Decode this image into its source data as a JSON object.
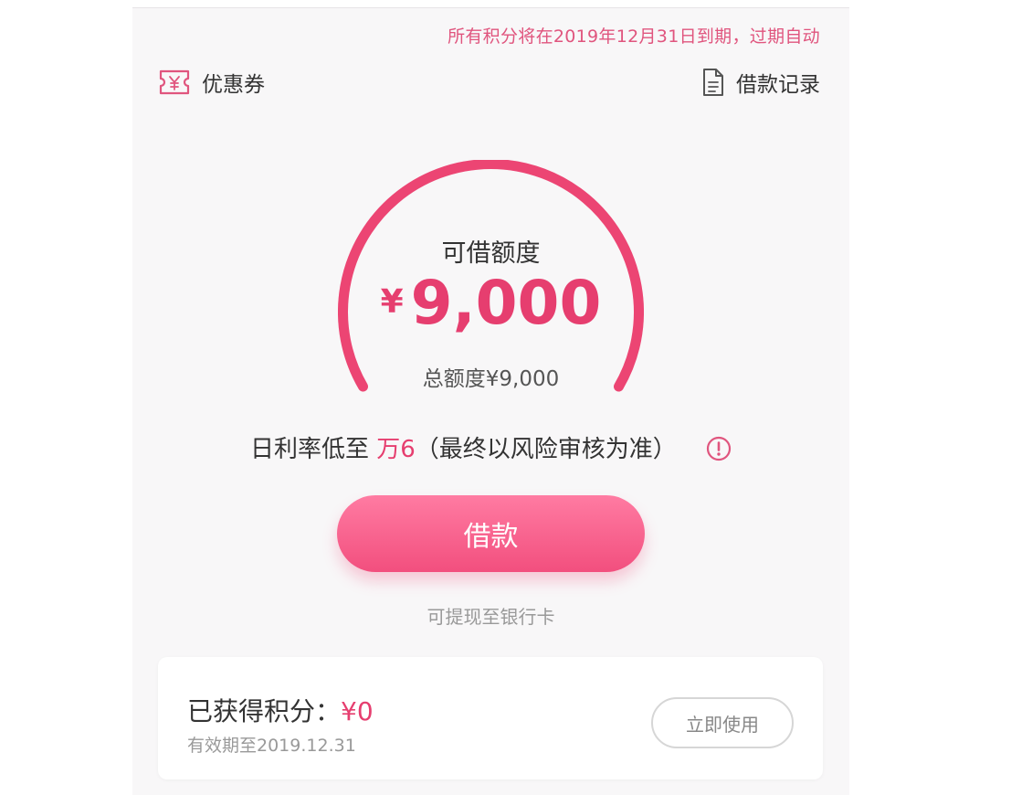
{
  "notice": "所有积分将在2019年12月31日到期，过期自动",
  "header": {
    "coupon_label": "优惠券",
    "records_label": "借款记录"
  },
  "icons": {
    "coupon": "coupon-icon",
    "records": "document-icon",
    "info": "info-icon"
  },
  "credit": {
    "title": "可借额度",
    "currency": "¥",
    "amount": "9,000",
    "total": "总额度¥9,000",
    "gauge_fill": 1.0
  },
  "rate": {
    "prefix": "日利率低至",
    "value": "万6",
    "suffix": "（最终以风险审核为准）"
  },
  "borrow_button": "借款",
  "withdraw_hint": "可提现至银行卡",
  "points": {
    "label": "已获得积分：",
    "value": "¥0",
    "expire": "有效期至2019.12.31",
    "use_button": "立即使用"
  },
  "colors": {
    "accent": "#e63e6f",
    "button": "#f24f7e",
    "notice": "#e0557e"
  }
}
